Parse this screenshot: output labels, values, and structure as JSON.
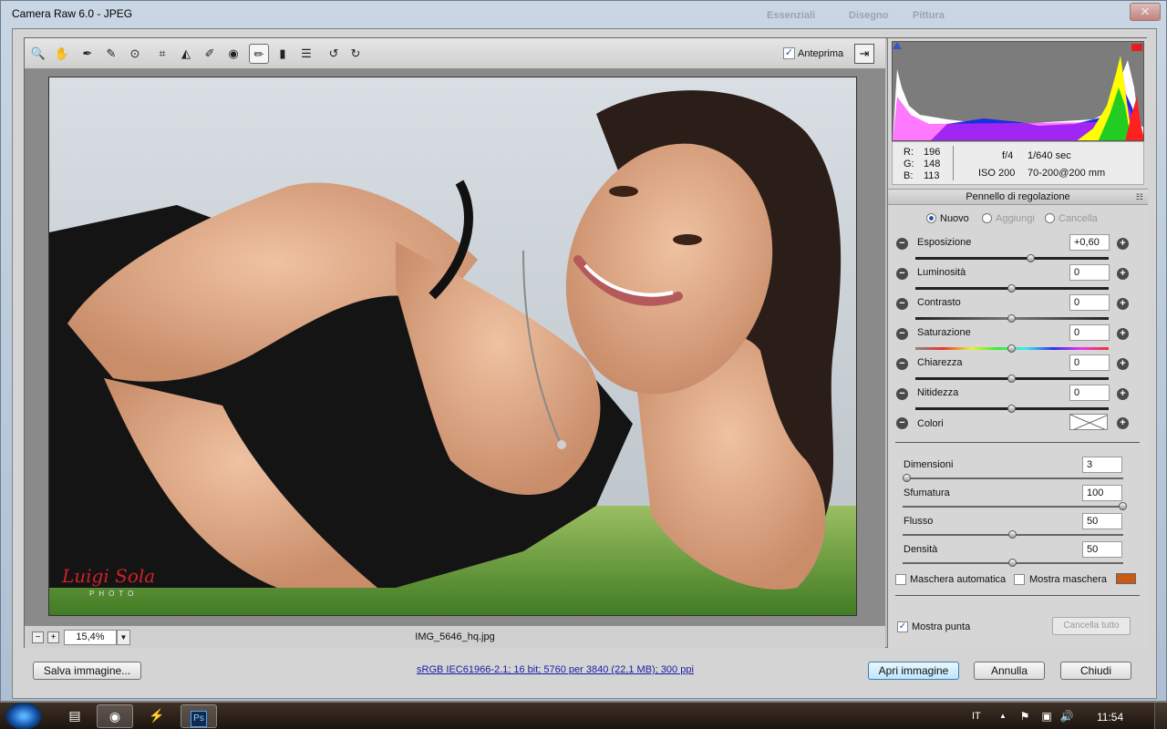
{
  "window": {
    "title": "Camera Raw 6.0  -  JPEG"
  },
  "ps_menu_ghost": [
    "Essenziali",
    "Disegno",
    "Pittura"
  ],
  "toolbar": {
    "tools": [
      {
        "name": "zoom-tool-icon",
        "glyph": "🔍"
      },
      {
        "name": "hand-tool-icon",
        "glyph": "✋"
      },
      {
        "name": "white-balance-tool-icon",
        "glyph": "✒"
      },
      {
        "name": "color-sampler-tool-icon",
        "glyph": "✎"
      },
      {
        "name": "targeted-adjustment-tool-icon",
        "glyph": "⊙"
      },
      {
        "name": "crop-tool-icon",
        "glyph": "⌗"
      },
      {
        "name": "straighten-tool-icon",
        "glyph": "◭"
      },
      {
        "name": "spot-removal-tool-icon",
        "glyph": "✐"
      },
      {
        "name": "red-eye-tool-icon",
        "glyph": "◉"
      },
      {
        "name": "adjustment-brush-tool-icon",
        "glyph": "✏"
      },
      {
        "name": "graduated-filter-tool-icon",
        "glyph": "▮"
      },
      {
        "name": "preferences-icon",
        "glyph": "☰"
      },
      {
        "name": "rotate-ccw-icon",
        "glyph": "↺"
      },
      {
        "name": "rotate-cw-icon",
        "glyph": "↻"
      }
    ],
    "preview_label": "Anteprima",
    "preview_checked": "✓",
    "fullscreen_glyph": "⇥"
  },
  "watermark": {
    "name": "Luigi Sola",
    "sub": "PHOTO"
  },
  "statusbar": {
    "zoom_out": "−",
    "zoom_in": "+",
    "zoom": "15,4%",
    "zoom_dd": "▼",
    "filename": "IMG_5646_hq.jpg"
  },
  "info": {
    "r_label": "R:",
    "r": "196",
    "g_label": "G:",
    "g": "148",
    "b_label": "B:",
    "b": "113",
    "aperture": "f/4",
    "shutter": "1/640 sec",
    "iso": "ISO 200",
    "lens": "70-200@200 mm"
  },
  "panel": {
    "title": "Pennello di regolazione",
    "menu_glyph": "☷",
    "mode_new": "Nuovo",
    "mode_add": "Aggiungi",
    "mode_erase": "Cancella",
    "minus": "−",
    "plus": "+",
    "sliders": [
      {
        "label": "Esposizione",
        "value": "+0,60",
        "pos": 0.6
      },
      {
        "label": "Luminosità",
        "value": "0",
        "pos": 0.5
      },
      {
        "label": "Contrasto",
        "value": "0",
        "pos": 0.5
      },
      {
        "label": "Saturazione",
        "value": "0",
        "pos": 0.5
      },
      {
        "label": "Chiarezza",
        "value": "0",
        "pos": 0.5
      },
      {
        "label": "Nitidezza",
        "value": "0",
        "pos": 0.5
      }
    ],
    "colors_label": "Colori",
    "brush": [
      {
        "label": "Dimensioni",
        "value": "3",
        "pos": 0.02
      },
      {
        "label": "Sfumatura",
        "value": "100",
        "pos": 1.0
      },
      {
        "label": "Flusso",
        "value": "50",
        "pos": 0.5
      },
      {
        "label": "Densità",
        "value": "50",
        "pos": 0.5
      }
    ],
    "auto_mask": "Maschera automatica",
    "show_mask": "Mostra maschera",
    "mask_color": "#c85a14",
    "show_pins": "Mostra punta",
    "show_pins_checked": "✓",
    "clear_all": "Cancella tutto"
  },
  "footer": {
    "save": "Salva immagine...",
    "workflow": "sRGB IEC61966-2.1; 16 bit; 5760 per 3840 (22,1 MB); 300 ppi",
    "open": "Apri immagine",
    "cancel": "Annulla",
    "done": "Chiudi"
  },
  "taskbar": {
    "lang": "IT",
    "time": "11:54",
    "ps_label": "Ps",
    "tray_up": "▲",
    "volume": "🔊",
    "network": "▣",
    "flag": "⚑"
  }
}
